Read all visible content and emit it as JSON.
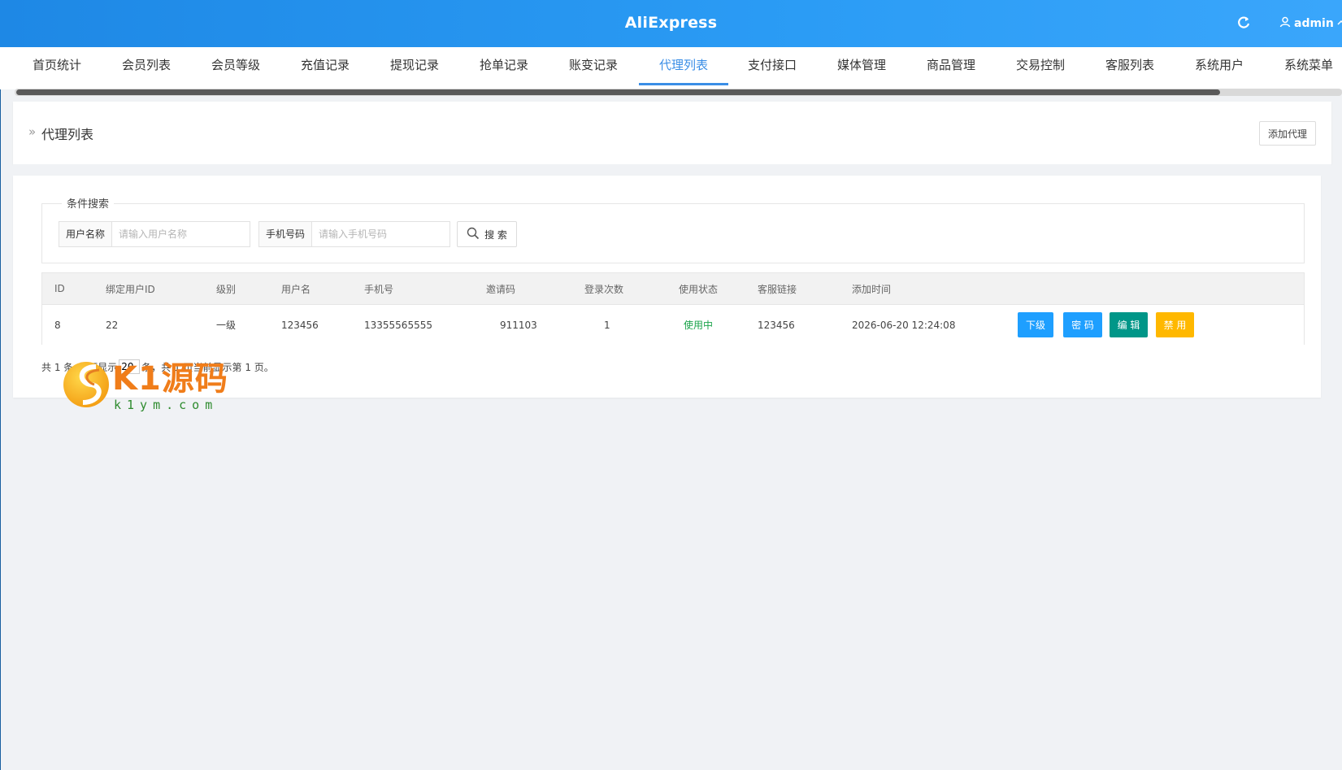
{
  "header": {
    "brand": "AliExpress",
    "user_name": "admin",
    "refresh_icon": "refresh-icon",
    "user_icon": "user-icon",
    "colors": {
      "bar": "#2b9cf5"
    }
  },
  "tabs": [
    {
      "label": "首页统计"
    },
    {
      "label": "会员列表"
    },
    {
      "label": "会员等级"
    },
    {
      "label": "充值记录"
    },
    {
      "label": "提现记录"
    },
    {
      "label": "抢单记录"
    },
    {
      "label": "账变记录"
    },
    {
      "label": "代理列表",
      "active": true
    },
    {
      "label": "支付接口"
    },
    {
      "label": "媒体管理"
    },
    {
      "label": "商品管理"
    },
    {
      "label": "交易控制"
    },
    {
      "label": "客服列表"
    },
    {
      "label": "系统用户"
    },
    {
      "label": "系统菜单"
    }
  ],
  "breadcrumb": {
    "arrow": "»",
    "title": "代理列表"
  },
  "actions": {
    "add_label": "添加代理"
  },
  "search": {
    "legend": "条件搜索",
    "username_label": "用户名称",
    "username_placeholder": "请输入用户名称",
    "phone_label": "手机号码",
    "phone_placeholder": "请输入手机号码",
    "button_label": "搜 索"
  },
  "table": {
    "columns": [
      "ID",
      "绑定用户ID",
      "级别",
      "用户名",
      "手机号",
      "邀请码",
      "登录次数",
      "使用状态",
      "客服链接",
      "添加时间"
    ],
    "rows": [
      {
        "id": "8",
        "bound_user_id": "22",
        "level": "一级",
        "username": "123456",
        "phone": "13355565555",
        "invite_code": "911103",
        "login_count": "1",
        "status": "使用中",
        "service_link": "123456",
        "created_at": "2026-06-20 12:24:08",
        "ops": {
          "sub": "下级",
          "pwd": "密 码",
          "edit": "编 辑",
          "ban": "禁 用"
        }
      }
    ]
  },
  "pager": {
    "prefix": "共 1 条",
    "per_page_prefix": "每页显示",
    "per_page_value": "20",
    "suffix": "条，共 1 页当前显示第 1 页。"
  },
  "watermark": {
    "text": "K1源码",
    "url": "k1ym.com"
  }
}
